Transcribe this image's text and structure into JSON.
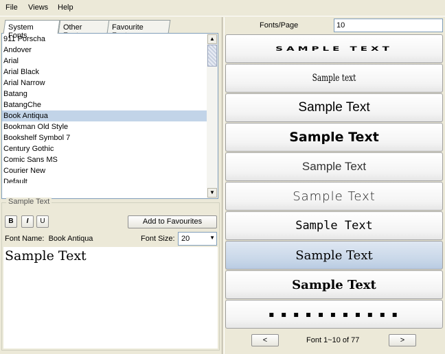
{
  "menu": {
    "file": "File",
    "views": "Views",
    "help": "Help"
  },
  "tabs": [
    "System Fonts",
    "Other Fonts",
    "Favourite Fonts"
  ],
  "font_list": [
    "911 Porscha",
    "Andover",
    "Arial",
    "Arial Black",
    "Arial Narrow",
    "Batang",
    "BatangChe",
    "Book Antiqua",
    "Bookman Old Style",
    "Bookshelf Symbol 7",
    "Century Gothic",
    "Comic Sans MS",
    "Courier New",
    "Default"
  ],
  "selected_font": "Book Antiqua",
  "sample_panel": {
    "legend": "Sample Text",
    "bold": "B",
    "italic": "I",
    "underline": "U",
    "add_favourites": "Add to Favourites",
    "font_name_label": "Font Name:",
    "font_name_value": "Book Antiqua",
    "font_size_label": "Font Size:",
    "font_size_value": "20",
    "sample_text": "Sample Text"
  },
  "fonts_per_page": {
    "label": "Fonts/Page",
    "value": "10"
  },
  "previews": [
    "SAMPLE TEXT",
    "Sample text",
    "Sample Text",
    "Sample Text",
    "Sample Text",
    "Sample Text",
    "Sample Text",
    "Sample Text",
    "Sample Text",
    "▪ ▪ ▪ ▪ ▪ ▪ ▪ ▪ ▪ ▪ ▪"
  ],
  "pagination": {
    "prev": "<",
    "next": ">",
    "info": "Font 1~10 of 77"
  },
  "colors": {
    "window_bg": "#ece9d8",
    "selection": "#c2d4e8",
    "border": "#7f9db9"
  }
}
